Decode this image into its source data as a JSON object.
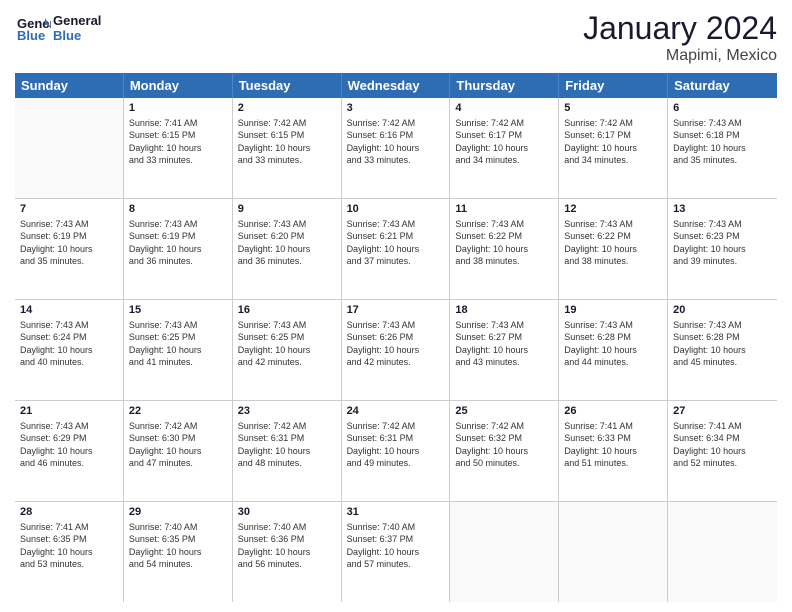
{
  "logo": {
    "line1": "General",
    "line2": "Blue"
  },
  "title": "January 2024",
  "subtitle": "Mapimi, Mexico",
  "header_days": [
    "Sunday",
    "Monday",
    "Tuesday",
    "Wednesday",
    "Thursday",
    "Friday",
    "Saturday"
  ],
  "weeks": [
    [
      {
        "day": "",
        "info": ""
      },
      {
        "day": "1",
        "info": "Sunrise: 7:41 AM\nSunset: 6:15 PM\nDaylight: 10 hours\nand 33 minutes."
      },
      {
        "day": "2",
        "info": "Sunrise: 7:42 AM\nSunset: 6:15 PM\nDaylight: 10 hours\nand 33 minutes."
      },
      {
        "day": "3",
        "info": "Sunrise: 7:42 AM\nSunset: 6:16 PM\nDaylight: 10 hours\nand 33 minutes."
      },
      {
        "day": "4",
        "info": "Sunrise: 7:42 AM\nSunset: 6:17 PM\nDaylight: 10 hours\nand 34 minutes."
      },
      {
        "day": "5",
        "info": "Sunrise: 7:42 AM\nSunset: 6:17 PM\nDaylight: 10 hours\nand 34 minutes."
      },
      {
        "day": "6",
        "info": "Sunrise: 7:43 AM\nSunset: 6:18 PM\nDaylight: 10 hours\nand 35 minutes."
      }
    ],
    [
      {
        "day": "7",
        "info": "Sunrise: 7:43 AM\nSunset: 6:19 PM\nDaylight: 10 hours\nand 35 minutes."
      },
      {
        "day": "8",
        "info": "Sunrise: 7:43 AM\nSunset: 6:19 PM\nDaylight: 10 hours\nand 36 minutes."
      },
      {
        "day": "9",
        "info": "Sunrise: 7:43 AM\nSunset: 6:20 PM\nDaylight: 10 hours\nand 36 minutes."
      },
      {
        "day": "10",
        "info": "Sunrise: 7:43 AM\nSunset: 6:21 PM\nDaylight: 10 hours\nand 37 minutes."
      },
      {
        "day": "11",
        "info": "Sunrise: 7:43 AM\nSunset: 6:22 PM\nDaylight: 10 hours\nand 38 minutes."
      },
      {
        "day": "12",
        "info": "Sunrise: 7:43 AM\nSunset: 6:22 PM\nDaylight: 10 hours\nand 38 minutes."
      },
      {
        "day": "13",
        "info": "Sunrise: 7:43 AM\nSunset: 6:23 PM\nDaylight: 10 hours\nand 39 minutes."
      }
    ],
    [
      {
        "day": "14",
        "info": "Sunrise: 7:43 AM\nSunset: 6:24 PM\nDaylight: 10 hours\nand 40 minutes."
      },
      {
        "day": "15",
        "info": "Sunrise: 7:43 AM\nSunset: 6:25 PM\nDaylight: 10 hours\nand 41 minutes."
      },
      {
        "day": "16",
        "info": "Sunrise: 7:43 AM\nSunset: 6:25 PM\nDaylight: 10 hours\nand 42 minutes."
      },
      {
        "day": "17",
        "info": "Sunrise: 7:43 AM\nSunset: 6:26 PM\nDaylight: 10 hours\nand 42 minutes."
      },
      {
        "day": "18",
        "info": "Sunrise: 7:43 AM\nSunset: 6:27 PM\nDaylight: 10 hours\nand 43 minutes."
      },
      {
        "day": "19",
        "info": "Sunrise: 7:43 AM\nSunset: 6:28 PM\nDaylight: 10 hours\nand 44 minutes."
      },
      {
        "day": "20",
        "info": "Sunrise: 7:43 AM\nSunset: 6:28 PM\nDaylight: 10 hours\nand 45 minutes."
      }
    ],
    [
      {
        "day": "21",
        "info": "Sunrise: 7:43 AM\nSunset: 6:29 PM\nDaylight: 10 hours\nand 46 minutes."
      },
      {
        "day": "22",
        "info": "Sunrise: 7:42 AM\nSunset: 6:30 PM\nDaylight: 10 hours\nand 47 minutes."
      },
      {
        "day": "23",
        "info": "Sunrise: 7:42 AM\nSunset: 6:31 PM\nDaylight: 10 hours\nand 48 minutes."
      },
      {
        "day": "24",
        "info": "Sunrise: 7:42 AM\nSunset: 6:31 PM\nDaylight: 10 hours\nand 49 minutes."
      },
      {
        "day": "25",
        "info": "Sunrise: 7:42 AM\nSunset: 6:32 PM\nDaylight: 10 hours\nand 50 minutes."
      },
      {
        "day": "26",
        "info": "Sunrise: 7:41 AM\nSunset: 6:33 PM\nDaylight: 10 hours\nand 51 minutes."
      },
      {
        "day": "27",
        "info": "Sunrise: 7:41 AM\nSunset: 6:34 PM\nDaylight: 10 hours\nand 52 minutes."
      }
    ],
    [
      {
        "day": "28",
        "info": "Sunrise: 7:41 AM\nSunset: 6:35 PM\nDaylight: 10 hours\nand 53 minutes."
      },
      {
        "day": "29",
        "info": "Sunrise: 7:40 AM\nSunset: 6:35 PM\nDaylight: 10 hours\nand 54 minutes."
      },
      {
        "day": "30",
        "info": "Sunrise: 7:40 AM\nSunset: 6:36 PM\nDaylight: 10 hours\nand 56 minutes."
      },
      {
        "day": "31",
        "info": "Sunrise: 7:40 AM\nSunset: 6:37 PM\nDaylight: 10 hours\nand 57 minutes."
      },
      {
        "day": "",
        "info": ""
      },
      {
        "day": "",
        "info": ""
      },
      {
        "day": "",
        "info": ""
      }
    ]
  ]
}
